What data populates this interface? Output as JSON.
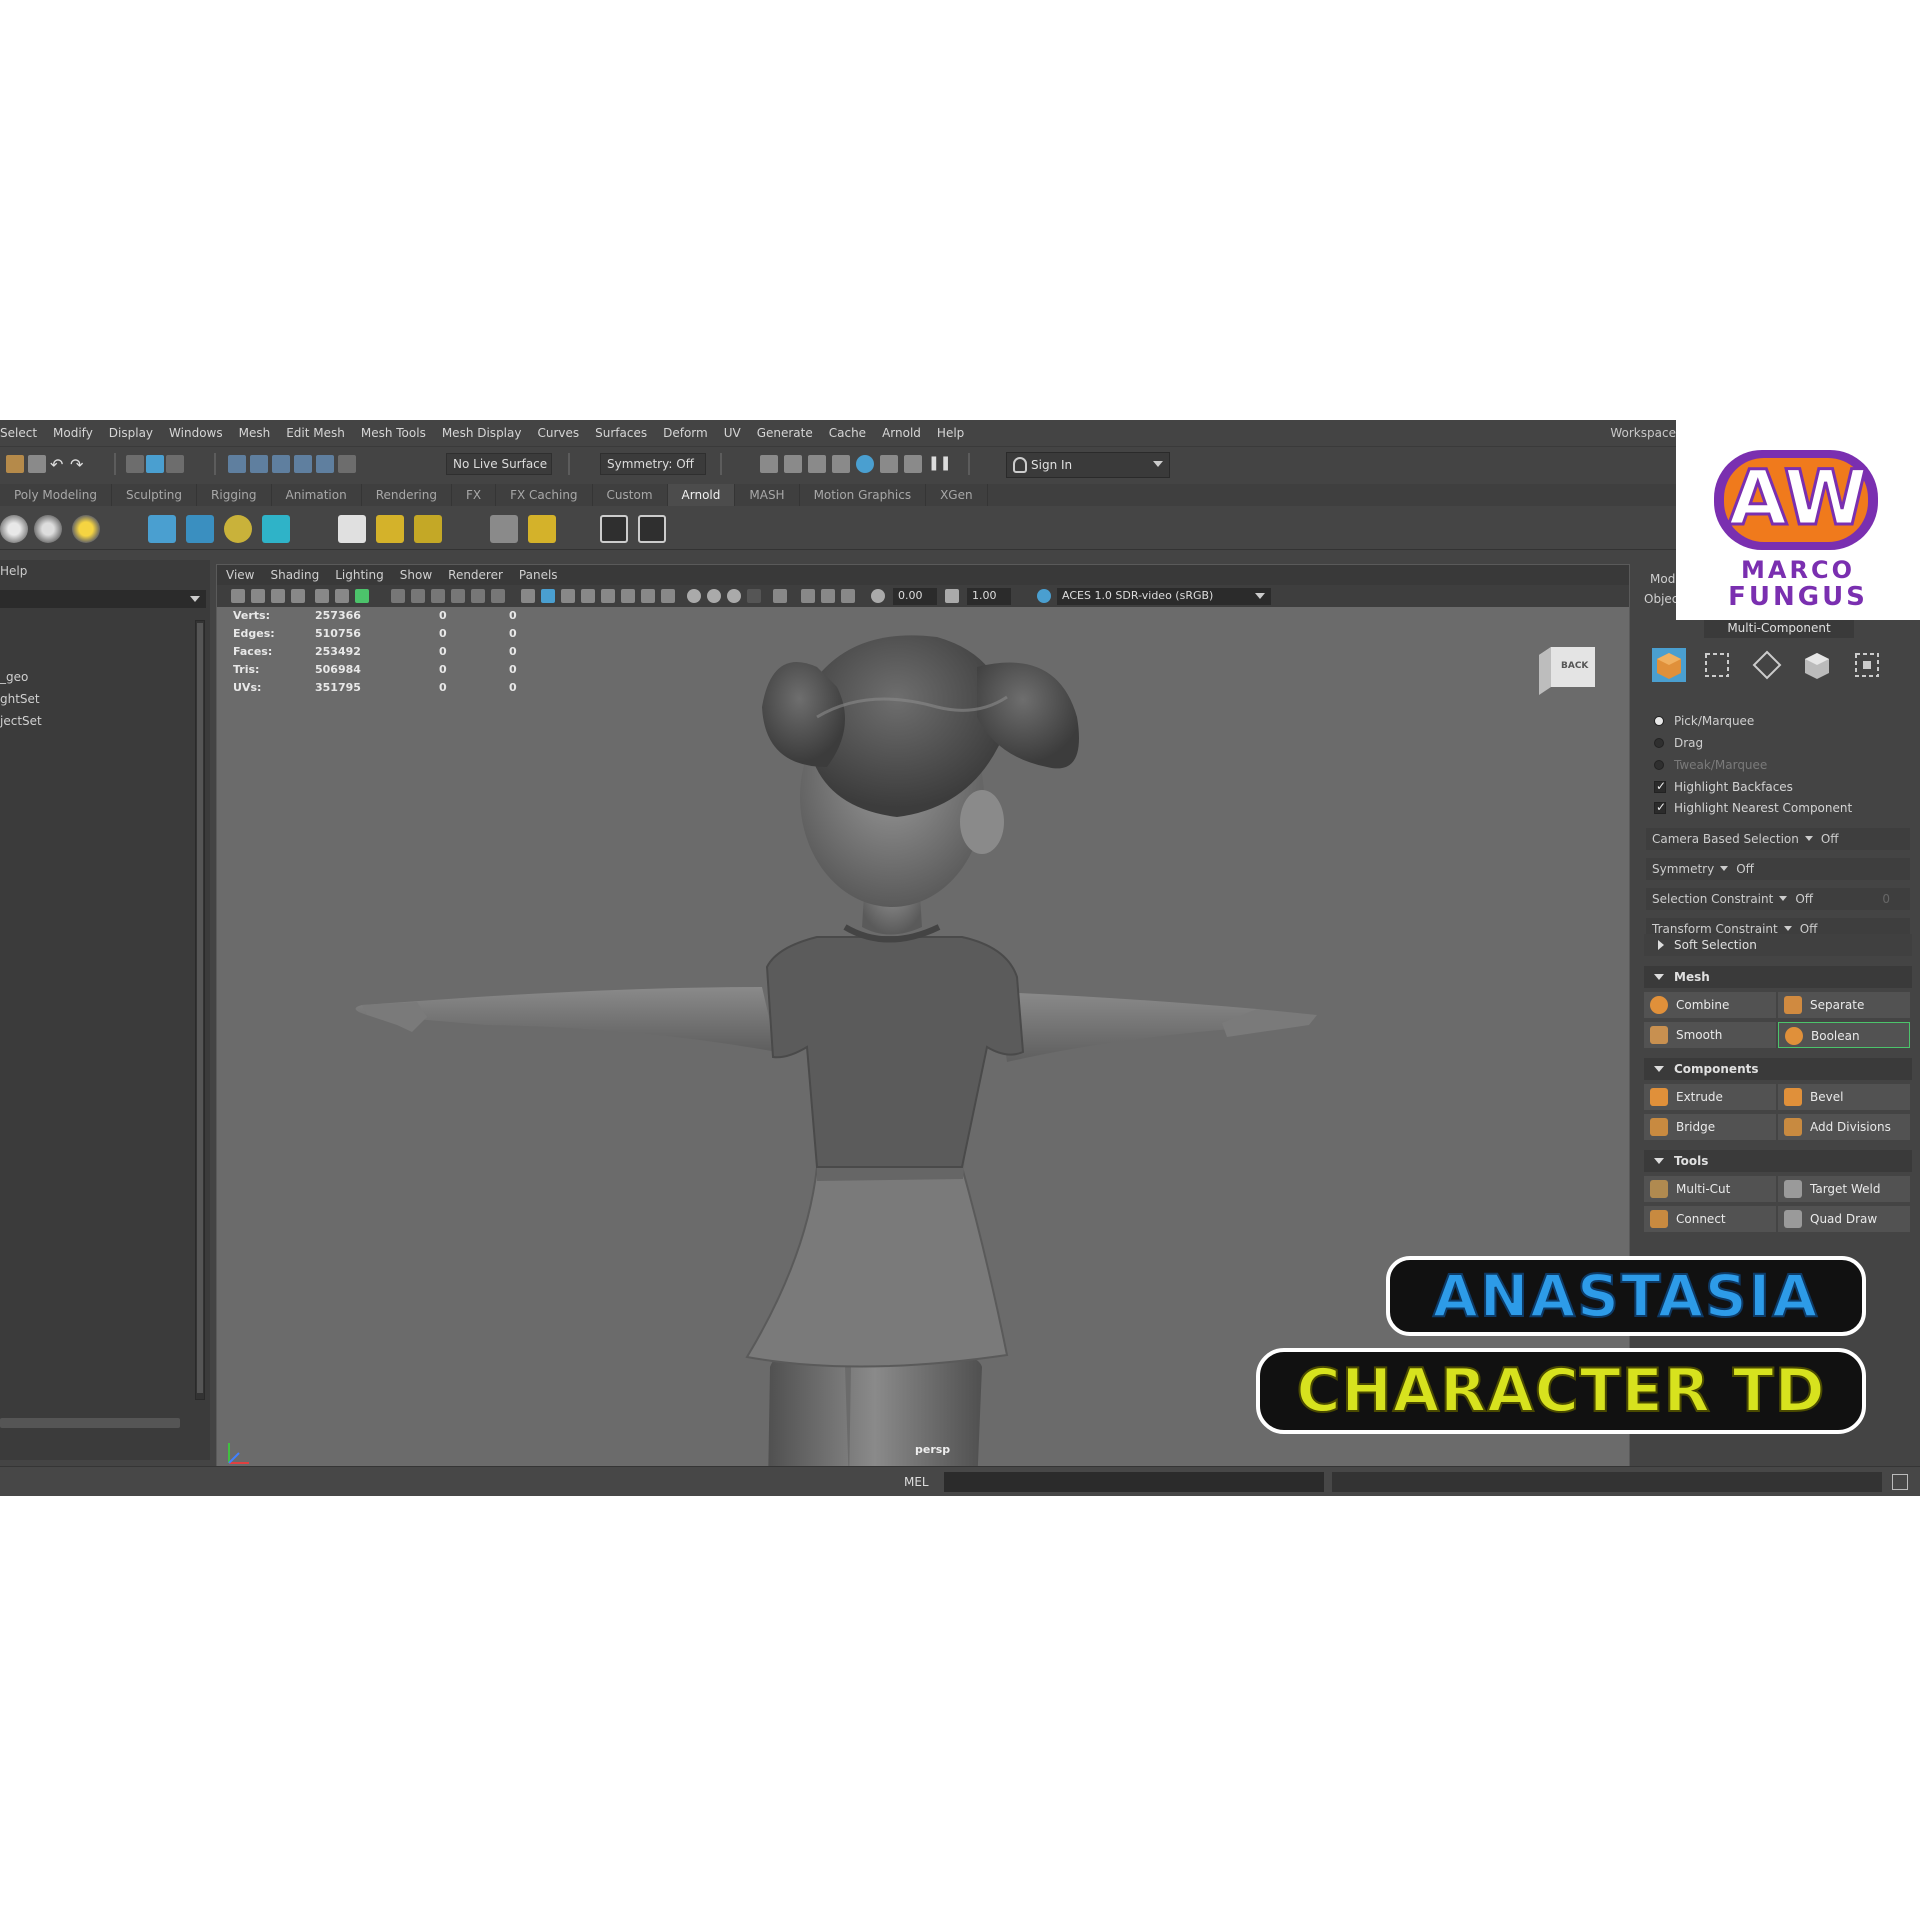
{
  "menu": {
    "items": [
      "Select",
      "Modify",
      "Display",
      "Windows",
      "Mesh",
      "Edit Mesh",
      "Mesh Tools",
      "Mesh Display",
      "Curves",
      "Surfaces",
      "Deform",
      "UV",
      "Generate",
      "Cache",
      "Arnold",
      "Help"
    ],
    "workspace_label": "Workspace:"
  },
  "status_toolbar": {
    "live_surface": "No Live Surface",
    "symmetry": "Symmetry: Off",
    "sign_in": "Sign In"
  },
  "shelf": {
    "tabs": [
      "Poly Modeling",
      "Sculpting",
      "Rigging",
      "Animation",
      "Rendering",
      "FX",
      "FX Caching",
      "Custom",
      "Arnold",
      "MASH",
      "Motion Graphics",
      "XGen"
    ],
    "active_tab": "Arnold"
  },
  "outliner": {
    "header": "Help",
    "items": [
      "_geo",
      "ghtSet",
      "jectSet"
    ]
  },
  "viewport": {
    "menu": [
      "View",
      "Shading",
      "Lighting",
      "Show",
      "Renderer",
      "Panels"
    ],
    "exposure": "0.00",
    "gamma": "1.00",
    "color_space": "ACES 1.0 SDR-video (sRGB)",
    "hud": [
      {
        "label": "Verts:",
        "v1": "257366",
        "v2": "0",
        "v3": "0"
      },
      {
        "label": "Edges:",
        "v1": "510756",
        "v2": "0",
        "v3": "0"
      },
      {
        "label": "Faces:",
        "v1": "253492",
        "v2": "0",
        "v3": "0"
      },
      {
        "label": "Tris:",
        "v1": "506984",
        "v2": "0",
        "v3": "0"
      },
      {
        "label": "UVs:",
        "v1": "351795",
        "v2": "0",
        "v3": "0"
      }
    ],
    "viewcube_label": "BACK",
    "camera": "persp"
  },
  "toolkit": {
    "header_1": "Mod",
    "header_2": "Objec",
    "multi_component": "Multi-Component",
    "radio": {
      "pick": "Pick/Marquee",
      "drag": "Drag",
      "tweak": "Tweak/Marquee"
    },
    "checks": {
      "backfaces": "Highlight Backfaces",
      "nearest": "Highlight Nearest Component"
    },
    "options": [
      {
        "label": "Camera Based Selection",
        "value": "Off",
        "extra": ""
      },
      {
        "label": "Symmetry",
        "value": "Off",
        "extra": ""
      },
      {
        "label": "Selection Constraint",
        "value": "Off",
        "extra": "0"
      },
      {
        "label": "Transform Constraint",
        "value": "Off",
        "extra": ""
      }
    ],
    "soft_selection": "Soft Selection",
    "sections": {
      "mesh": "Mesh",
      "components": "Components",
      "tools": "Tools"
    },
    "mesh_buttons": [
      "Combine",
      "Separate",
      "Smooth",
      "Boolean"
    ],
    "component_buttons": [
      "Extrude",
      "Bevel",
      "Bridge",
      "Add Divisions"
    ],
    "tool_buttons": [
      "Multi-Cut",
      "Target Weld",
      "Connect",
      "Quad Draw"
    ]
  },
  "command_line": {
    "label": "MEL"
  },
  "overlay": {
    "logo_text": "AW",
    "logo_name_1": "MARCO",
    "logo_name_2": "FUNGUS",
    "title_1": "ANASTASIA",
    "title_2": "CHARACTER TD"
  },
  "colors": {
    "ui_bg": "#444444",
    "viewport_bg": "#6b6b6b",
    "accent_blue": "#4a9fd0",
    "icon_orange": "#e0903a",
    "title_blue": "#2d9be8",
    "title_yellow": "#d7e21e",
    "logo_purple": "#7a2fb0",
    "logo_orange": "#f07a1c"
  }
}
